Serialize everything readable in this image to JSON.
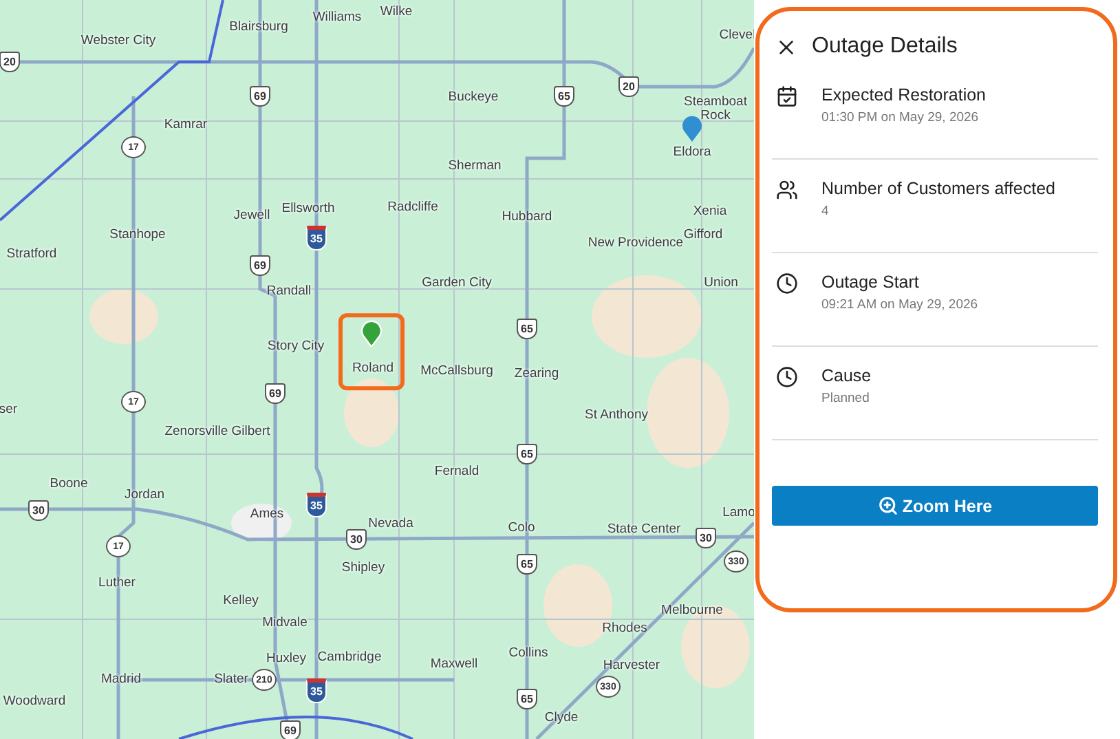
{
  "map": {
    "places": [
      "Blairsburg",
      "Williams",
      "Wilke",
      "Webster City",
      "Clevel",
      "Buckeye",
      "Steamboat Rock",
      "Kamrar",
      "Sherman",
      "Eldora",
      "Jewell",
      "Ellsworth",
      "Radcliffe",
      "Hubbard",
      "Xenia",
      "Stanhope",
      "New Providence",
      "Gifford",
      "Stratford",
      "Garden City",
      "Union",
      "Randall",
      "Story City",
      "Roland",
      "McCallsburg",
      "Zearing",
      "St Anthony",
      "ser",
      "Zenorsville Gilbert",
      "Fernald",
      "Boone",
      "Jordan",
      "Ames",
      "Nevada",
      "Colo",
      "State Center",
      "Lamo",
      "Shipley",
      "Luther",
      "Kelley",
      "Melbourne",
      "Midvale",
      "Rhodes",
      "Collins",
      "Huxley",
      "Cambridge",
      "Maxwell",
      "Harvester",
      "Madrid",
      "Slater",
      "Woodward",
      "Clyde"
    ],
    "highway_shields": [
      {
        "label": "20",
        "kind": "us"
      },
      {
        "label": "69",
        "kind": "us"
      },
      {
        "label": "65",
        "kind": "us"
      },
      {
        "label": "20",
        "kind": "us"
      },
      {
        "label": "17",
        "kind": "state"
      },
      {
        "label": "35",
        "kind": "interstate"
      },
      {
        "label": "69",
        "kind": "us"
      },
      {
        "label": "65",
        "kind": "us"
      },
      {
        "label": "69",
        "kind": "us"
      },
      {
        "label": "17",
        "kind": "state"
      },
      {
        "label": "65",
        "kind": "us"
      },
      {
        "label": "35",
        "kind": "interstate"
      },
      {
        "label": "30",
        "kind": "us"
      },
      {
        "label": "30",
        "kind": "us"
      },
      {
        "label": "17",
        "kind": "state"
      },
      {
        "label": "65",
        "kind": "us"
      },
      {
        "label": "30",
        "kind": "us"
      },
      {
        "label": "330",
        "kind": "state"
      },
      {
        "label": "210",
        "kind": "state"
      },
      {
        "label": "35",
        "kind": "interstate"
      },
      {
        "label": "330",
        "kind": "state"
      },
      {
        "label": "65",
        "kind": "us"
      },
      {
        "label": "69",
        "kind": "us"
      }
    ],
    "markers": [
      {
        "color": "#2f8fd1",
        "selected": false
      },
      {
        "color": "#34a33a",
        "selected": true
      }
    ]
  },
  "panel": {
    "title": "Outage Details",
    "details": [
      {
        "kind": "calendar",
        "label": "Expected Restoration",
        "value": "01:30 PM on May 29, 2026"
      },
      {
        "kind": "people",
        "label": "Number of Customers affected",
        "value": "4"
      },
      {
        "kind": "clock",
        "label": "Outage Start",
        "value": "09:21 AM on May 29, 2026"
      },
      {
        "kind": "clock",
        "label": "Cause",
        "value": "Planned"
      }
    ],
    "button": "Zoom Here"
  }
}
